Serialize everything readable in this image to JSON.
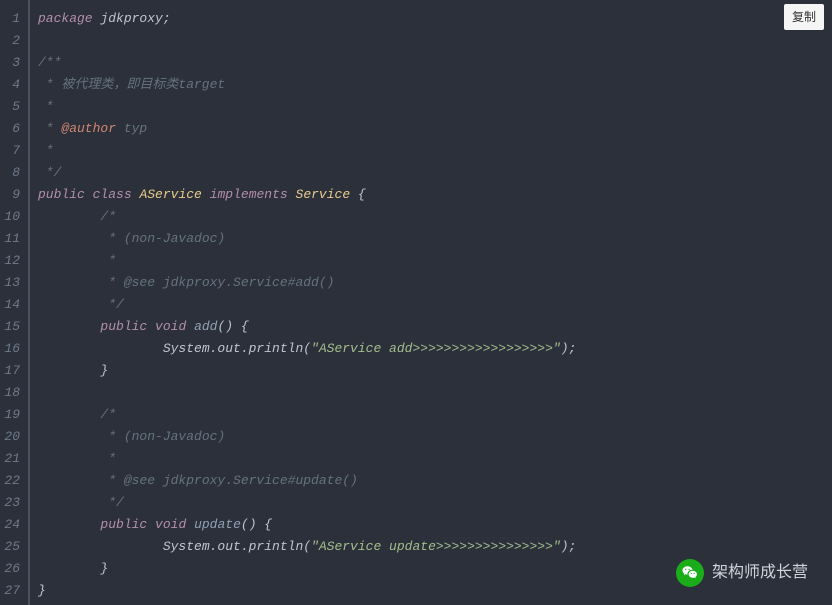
{
  "copy_label": "复制",
  "watermark_text": "架构师成长营",
  "lines": [
    {
      "n": 1,
      "tokens": [
        {
          "c": "k-pkg",
          "t": "package"
        },
        {
          "c": "k-punc",
          "t": " jdkproxy;"
        }
      ]
    },
    {
      "n": 2,
      "tokens": []
    },
    {
      "n": 3,
      "tokens": [
        {
          "c": "k-cmt",
          "t": "/**"
        }
      ]
    },
    {
      "n": 4,
      "tokens": [
        {
          "c": "k-cmt",
          "t": " * 被代理类，即目标类target"
        }
      ]
    },
    {
      "n": 5,
      "tokens": [
        {
          "c": "k-cmt",
          "t": " *"
        }
      ]
    },
    {
      "n": 6,
      "tokens": [
        {
          "c": "k-cmt",
          "t": " * "
        },
        {
          "c": "k-tag",
          "t": "@author"
        },
        {
          "c": "k-cmt",
          "t": " typ"
        }
      ]
    },
    {
      "n": 7,
      "tokens": [
        {
          "c": "k-cmt",
          "t": " *"
        }
      ]
    },
    {
      "n": 8,
      "tokens": [
        {
          "c": "k-cmt",
          "t": " */"
        }
      ]
    },
    {
      "n": 9,
      "tokens": [
        {
          "c": "k-pkg",
          "t": "public"
        },
        {
          "c": "k-punc",
          "t": " "
        },
        {
          "c": "k-pkg",
          "t": "class"
        },
        {
          "c": "k-punc",
          "t": " "
        },
        {
          "c": "k-type",
          "t": "AService"
        },
        {
          "c": "k-punc",
          "t": " "
        },
        {
          "c": "k-pkg",
          "t": "implements"
        },
        {
          "c": "k-punc",
          "t": " "
        },
        {
          "c": "k-type",
          "t": "Service"
        },
        {
          "c": "k-punc",
          "t": " {"
        }
      ]
    },
    {
      "n": 10,
      "tokens": [
        {
          "c": "k-cmt",
          "t": "        /*"
        }
      ]
    },
    {
      "n": 11,
      "tokens": [
        {
          "c": "k-cmt",
          "t": "         * (non-Javadoc)"
        }
      ]
    },
    {
      "n": 12,
      "tokens": [
        {
          "c": "k-cmt",
          "t": "         *"
        }
      ]
    },
    {
      "n": 13,
      "tokens": [
        {
          "c": "k-cmt",
          "t": "         * @see jdkproxy.Service#add()"
        }
      ]
    },
    {
      "n": 14,
      "tokens": [
        {
          "c": "k-cmt",
          "t": "         */"
        }
      ]
    },
    {
      "n": 15,
      "tokens": [
        {
          "c": "k-punc",
          "t": "        "
        },
        {
          "c": "k-pkg",
          "t": "public"
        },
        {
          "c": "k-punc",
          "t": " "
        },
        {
          "c": "k-pkg",
          "t": "void"
        },
        {
          "c": "k-punc",
          "t": " "
        },
        {
          "c": "k-fn",
          "t": "add"
        },
        {
          "c": "k-punc",
          "t": "() {"
        }
      ]
    },
    {
      "n": 16,
      "tokens": [
        {
          "c": "k-punc",
          "t": "                System.out.println("
        },
        {
          "c": "k-str",
          "t": "\"AService add>>>>>>>>>>>>>>>>>>\""
        },
        {
          "c": "k-punc",
          "t": ");"
        }
      ]
    },
    {
      "n": 17,
      "tokens": [
        {
          "c": "k-punc",
          "t": "        }"
        }
      ]
    },
    {
      "n": 18,
      "tokens": []
    },
    {
      "n": 19,
      "tokens": [
        {
          "c": "k-cmt",
          "t": "        /*"
        }
      ]
    },
    {
      "n": 20,
      "tokens": [
        {
          "c": "k-cmt",
          "t": "         * (non-Javadoc)"
        }
      ]
    },
    {
      "n": 21,
      "tokens": [
        {
          "c": "k-cmt",
          "t": "         *"
        }
      ]
    },
    {
      "n": 22,
      "tokens": [
        {
          "c": "k-cmt",
          "t": "         * @see jdkproxy.Service#update()"
        }
      ]
    },
    {
      "n": 23,
      "tokens": [
        {
          "c": "k-cmt",
          "t": "         */"
        }
      ]
    },
    {
      "n": 24,
      "tokens": [
        {
          "c": "k-punc",
          "t": "        "
        },
        {
          "c": "k-pkg",
          "t": "public"
        },
        {
          "c": "k-punc",
          "t": " "
        },
        {
          "c": "k-pkg",
          "t": "void"
        },
        {
          "c": "k-punc",
          "t": " "
        },
        {
          "c": "k-fn",
          "t": "update"
        },
        {
          "c": "k-punc",
          "t": "() {"
        }
      ]
    },
    {
      "n": 25,
      "tokens": [
        {
          "c": "k-punc",
          "t": "                System.out.println("
        },
        {
          "c": "k-str",
          "t": "\"AService update>>>>>>>>>>>>>>>\""
        },
        {
          "c": "k-punc",
          "t": ");"
        }
      ]
    },
    {
      "n": 26,
      "tokens": [
        {
          "c": "k-punc",
          "t": "        }"
        }
      ]
    },
    {
      "n": 27,
      "tokens": [
        {
          "c": "k-punc",
          "t": "}"
        }
      ]
    }
  ]
}
